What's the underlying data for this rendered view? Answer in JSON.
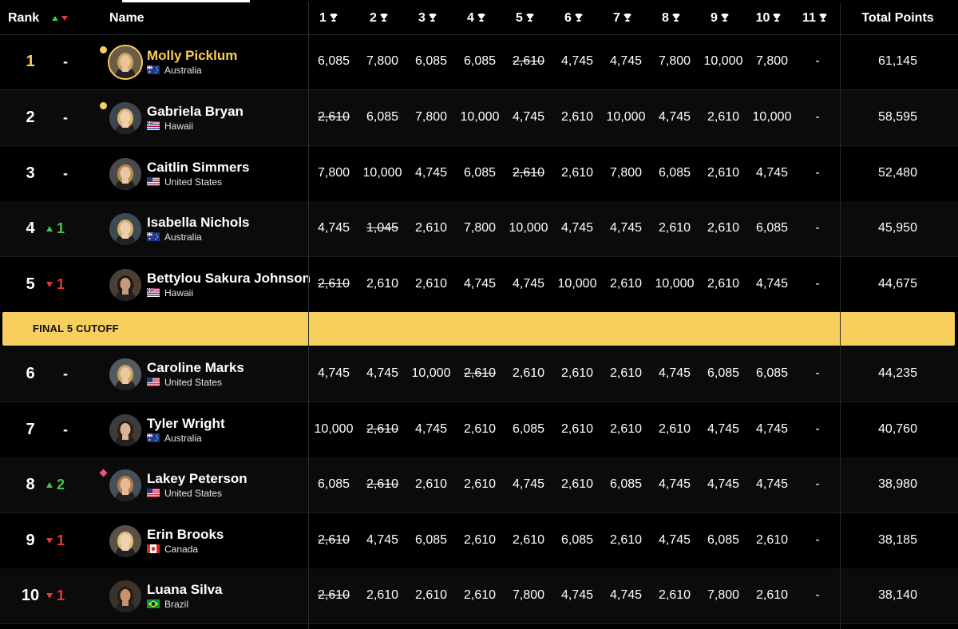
{
  "header": {
    "rank_label": "Rank",
    "name_label": "Name",
    "events": [
      "1",
      "2",
      "3",
      "4",
      "5",
      "6",
      "7",
      "8",
      "9",
      "10",
      "11"
    ],
    "total_label": "Total Points",
    "trophy_icon": "trophy-icon",
    "sort_icon": "sort-arrows-icon"
  },
  "cutoff_label": "FINAL 5 CUTOFF",
  "colors": {
    "accent": "#f7cf5d",
    "up": "#4cc24c",
    "down": "#e23a3a",
    "background": "#000000"
  },
  "rows": [
    {
      "rank": "1",
      "move": "-",
      "move_dir": "none",
      "name": "Molly Picklum",
      "country": "Australia",
      "flag": "australia",
      "leader": true,
      "badge": "gold-dot",
      "scores": [
        {
          "v": "6,085",
          "dropped": false
        },
        {
          "v": "7,800",
          "dropped": false
        },
        {
          "v": "6,085",
          "dropped": false
        },
        {
          "v": "6,085",
          "dropped": false
        },
        {
          "v": "2,610",
          "dropped": true
        },
        {
          "v": "4,745",
          "dropped": false
        },
        {
          "v": "4,745",
          "dropped": false
        },
        {
          "v": "7,800",
          "dropped": false
        },
        {
          "v": "10,000",
          "dropped": false
        },
        {
          "v": "7,800",
          "dropped": false
        },
        {
          "v": "-",
          "dropped": false
        }
      ],
      "total": "61,145"
    },
    {
      "rank": "2",
      "move": "-",
      "move_dir": "none",
      "name": "Gabriela Bryan",
      "country": "Hawaii",
      "flag": "hawaii",
      "leader": false,
      "badge": "gold-dot",
      "scores": [
        {
          "v": "2,610",
          "dropped": true
        },
        {
          "v": "6,085",
          "dropped": false
        },
        {
          "v": "7,800",
          "dropped": false
        },
        {
          "v": "10,000",
          "dropped": false
        },
        {
          "v": "4,745",
          "dropped": false
        },
        {
          "v": "2,610",
          "dropped": false
        },
        {
          "v": "10,000",
          "dropped": false
        },
        {
          "v": "4,745",
          "dropped": false
        },
        {
          "v": "2,610",
          "dropped": false
        },
        {
          "v": "10,000",
          "dropped": false
        },
        {
          "v": "-",
          "dropped": false
        }
      ],
      "total": "58,595"
    },
    {
      "rank": "3",
      "move": "-",
      "move_dir": "none",
      "name": "Caitlin Simmers",
      "country": "United States",
      "flag": "usa",
      "leader": false,
      "badge": "none",
      "scores": [
        {
          "v": "7,800",
          "dropped": false
        },
        {
          "v": "10,000",
          "dropped": false
        },
        {
          "v": "4,745",
          "dropped": false
        },
        {
          "v": "6,085",
          "dropped": false
        },
        {
          "v": "2,610",
          "dropped": true
        },
        {
          "v": "2,610",
          "dropped": false
        },
        {
          "v": "7,800",
          "dropped": false
        },
        {
          "v": "6,085",
          "dropped": false
        },
        {
          "v": "2,610",
          "dropped": false
        },
        {
          "v": "4,745",
          "dropped": false
        },
        {
          "v": "-",
          "dropped": false
        }
      ],
      "total": "52,480"
    },
    {
      "rank": "4",
      "move": "1",
      "move_dir": "up",
      "name": "Isabella Nichols",
      "country": "Australia",
      "flag": "australia",
      "leader": false,
      "badge": "none",
      "scores": [
        {
          "v": "4,745",
          "dropped": false
        },
        {
          "v": "1,045",
          "dropped": true
        },
        {
          "v": "2,610",
          "dropped": false
        },
        {
          "v": "7,800",
          "dropped": false
        },
        {
          "v": "10,000",
          "dropped": false
        },
        {
          "v": "4,745",
          "dropped": false
        },
        {
          "v": "4,745",
          "dropped": false
        },
        {
          "v": "2,610",
          "dropped": false
        },
        {
          "v": "2,610",
          "dropped": false
        },
        {
          "v": "6,085",
          "dropped": false
        },
        {
          "v": "-",
          "dropped": false
        }
      ],
      "total": "45,950"
    },
    {
      "rank": "5",
      "move": "1",
      "move_dir": "down",
      "name": "Bettylou Sakura Johnson",
      "country": "Hawaii",
      "flag": "hawaii",
      "leader": false,
      "badge": "none",
      "scores": [
        {
          "v": "2,610",
          "dropped": true
        },
        {
          "v": "2,610",
          "dropped": false
        },
        {
          "v": "2,610",
          "dropped": false
        },
        {
          "v": "4,745",
          "dropped": false
        },
        {
          "v": "4,745",
          "dropped": false
        },
        {
          "v": "10,000",
          "dropped": false
        },
        {
          "v": "2,610",
          "dropped": false
        },
        {
          "v": "10,000",
          "dropped": false
        },
        {
          "v": "2,610",
          "dropped": false
        },
        {
          "v": "4,745",
          "dropped": false
        },
        {
          "v": "-",
          "dropped": false
        }
      ],
      "total": "44,675"
    },
    {
      "rank": "6",
      "move": "-",
      "move_dir": "none",
      "name": "Caroline Marks",
      "country": "United States",
      "flag": "usa",
      "leader": false,
      "badge": "none",
      "scores": [
        {
          "v": "4,745",
          "dropped": false
        },
        {
          "v": "4,745",
          "dropped": false
        },
        {
          "v": "10,000",
          "dropped": false
        },
        {
          "v": "2,610",
          "dropped": true
        },
        {
          "v": "2,610",
          "dropped": false
        },
        {
          "v": "2,610",
          "dropped": false
        },
        {
          "v": "2,610",
          "dropped": false
        },
        {
          "v": "4,745",
          "dropped": false
        },
        {
          "v": "6,085",
          "dropped": false
        },
        {
          "v": "6,085",
          "dropped": false
        },
        {
          "v": "-",
          "dropped": false
        }
      ],
      "total": "44,235"
    },
    {
      "rank": "7",
      "move": "-",
      "move_dir": "none",
      "name": "Tyler Wright",
      "country": "Australia",
      "flag": "australia",
      "leader": false,
      "badge": "none",
      "scores": [
        {
          "v": "10,000",
          "dropped": false
        },
        {
          "v": "2,610",
          "dropped": true
        },
        {
          "v": "4,745",
          "dropped": false
        },
        {
          "v": "2,610",
          "dropped": false
        },
        {
          "v": "6,085",
          "dropped": false
        },
        {
          "v": "2,610",
          "dropped": false
        },
        {
          "v": "2,610",
          "dropped": false
        },
        {
          "v": "2,610",
          "dropped": false
        },
        {
          "v": "4,745",
          "dropped": false
        },
        {
          "v": "4,745",
          "dropped": false
        },
        {
          "v": "-",
          "dropped": false
        }
      ],
      "total": "40,760"
    },
    {
      "rank": "8",
      "move": "2",
      "move_dir": "up",
      "name": "Lakey Peterson",
      "country": "United States",
      "flag": "usa",
      "leader": false,
      "badge": "pink-diamond",
      "scores": [
        {
          "v": "6,085",
          "dropped": false
        },
        {
          "v": "2,610",
          "dropped": true
        },
        {
          "v": "2,610",
          "dropped": false
        },
        {
          "v": "2,610",
          "dropped": false
        },
        {
          "v": "4,745",
          "dropped": false
        },
        {
          "v": "2,610",
          "dropped": false
        },
        {
          "v": "6,085",
          "dropped": false
        },
        {
          "v": "4,745",
          "dropped": false
        },
        {
          "v": "4,745",
          "dropped": false
        },
        {
          "v": "4,745",
          "dropped": false
        },
        {
          "v": "-",
          "dropped": false
        }
      ],
      "total": "38,980"
    },
    {
      "rank": "9",
      "move": "1",
      "move_dir": "down",
      "name": "Erin Brooks",
      "country": "Canada",
      "flag": "canada",
      "leader": false,
      "badge": "none",
      "scores": [
        {
          "v": "2,610",
          "dropped": true
        },
        {
          "v": "4,745",
          "dropped": false
        },
        {
          "v": "6,085",
          "dropped": false
        },
        {
          "v": "2,610",
          "dropped": false
        },
        {
          "v": "2,610",
          "dropped": false
        },
        {
          "v": "6,085",
          "dropped": false
        },
        {
          "v": "2,610",
          "dropped": false
        },
        {
          "v": "4,745",
          "dropped": false
        },
        {
          "v": "6,085",
          "dropped": false
        },
        {
          "v": "2,610",
          "dropped": false
        },
        {
          "v": "-",
          "dropped": false
        }
      ],
      "total": "38,185"
    },
    {
      "rank": "10",
      "move": "1",
      "move_dir": "down",
      "name": "Luana Silva",
      "country": "Brazil",
      "flag": "brazil",
      "leader": false,
      "badge": "none",
      "scores": [
        {
          "v": "2,610",
          "dropped": true
        },
        {
          "v": "2,610",
          "dropped": false
        },
        {
          "v": "2,610",
          "dropped": false
        },
        {
          "v": "2,610",
          "dropped": false
        },
        {
          "v": "7,800",
          "dropped": false
        },
        {
          "v": "4,745",
          "dropped": false
        },
        {
          "v": "4,745",
          "dropped": false
        },
        {
          "v": "2,610",
          "dropped": false
        },
        {
          "v": "7,800",
          "dropped": false
        },
        {
          "v": "2,610",
          "dropped": false
        },
        {
          "v": "-",
          "dropped": false
        }
      ],
      "total": "38,140"
    }
  ]
}
